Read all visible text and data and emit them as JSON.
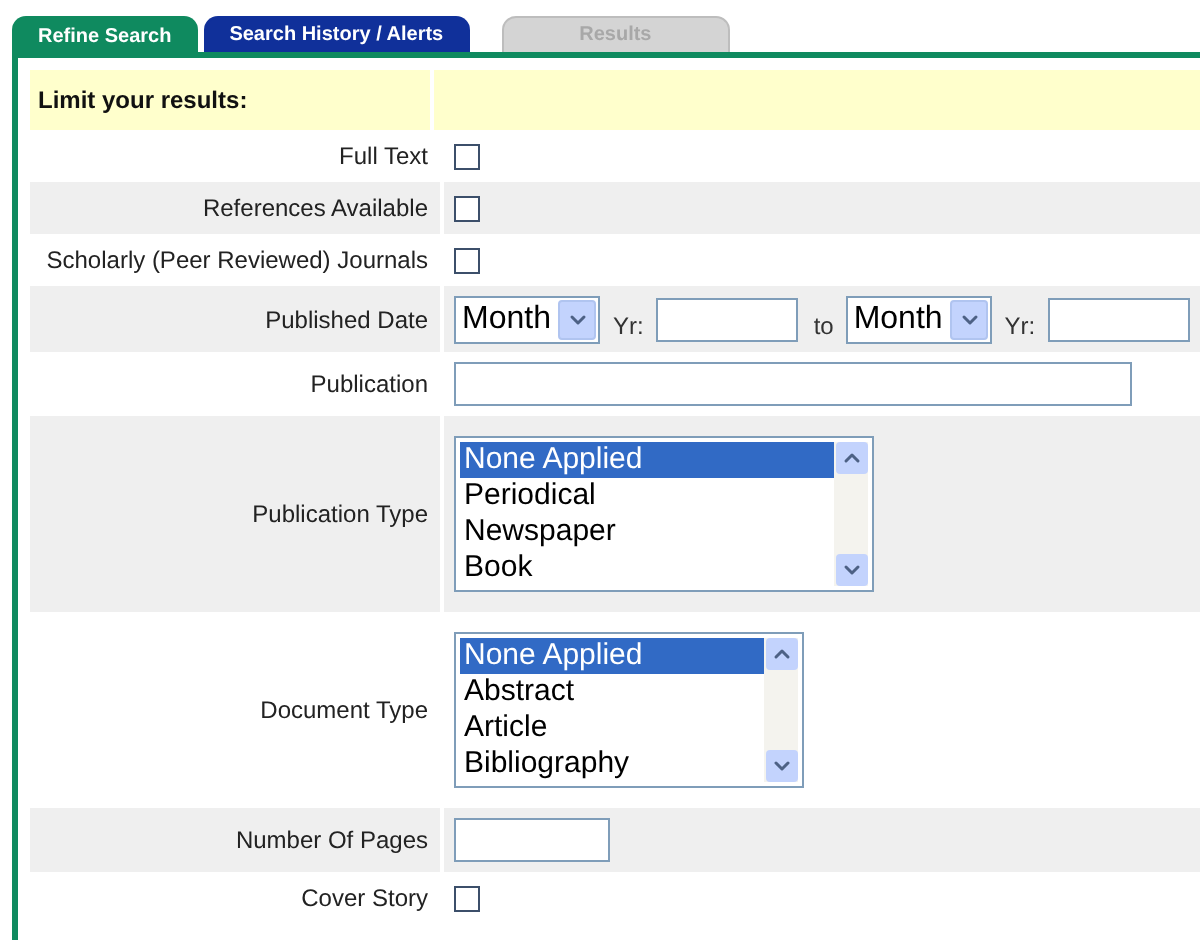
{
  "tabs": [
    {
      "label": "Refine Search",
      "selected": true,
      "disabled": false,
      "color": "#0f8a5f"
    },
    {
      "label": "Search History / Alerts",
      "selected": false,
      "disabled": false,
      "color": "#10309a"
    },
    {
      "label": "Results",
      "selected": false,
      "disabled": true,
      "color": "#d4d4d4"
    }
  ],
  "heading": "Limit your results:",
  "rows": [
    {
      "kind": "checkbox",
      "label": "Full Text",
      "checked": false
    },
    {
      "kind": "checkbox",
      "label": "References Available",
      "checked": false
    },
    {
      "kind": "checkbox",
      "label": "Scholarly (Peer Reviewed) Journals",
      "checked": false
    },
    {
      "kind": "date_range",
      "label": "Published Date",
      "from_month": "Month",
      "from_year_label": "Yr:",
      "to_label": "to",
      "to_month": "Month",
      "to_year_label": "Yr:"
    },
    {
      "kind": "long_text",
      "label": "Publication"
    },
    {
      "kind": "wide_listbox",
      "label": "Publication Type",
      "options": [
        {
          "label": "None Applied",
          "selected": true
        },
        {
          "label": "Periodical",
          "selected": false
        },
        {
          "label": "Newspaper",
          "selected": false
        },
        {
          "label": "Book",
          "selected": false
        }
      ]
    },
    {
      "kind": "narrow_listbox",
      "label": "Document Type",
      "options": [
        {
          "label": "None Applied",
          "selected": true
        },
        {
          "label": "Abstract",
          "selected": false
        },
        {
          "label": "Article",
          "selected": false
        },
        {
          "label": "Bibliography",
          "selected": false
        }
      ]
    },
    {
      "kind": "short_text",
      "label": "Number Of Pages"
    },
    {
      "kind": "checkbox",
      "label": "Cover Story",
      "checked": false
    }
  ]
}
